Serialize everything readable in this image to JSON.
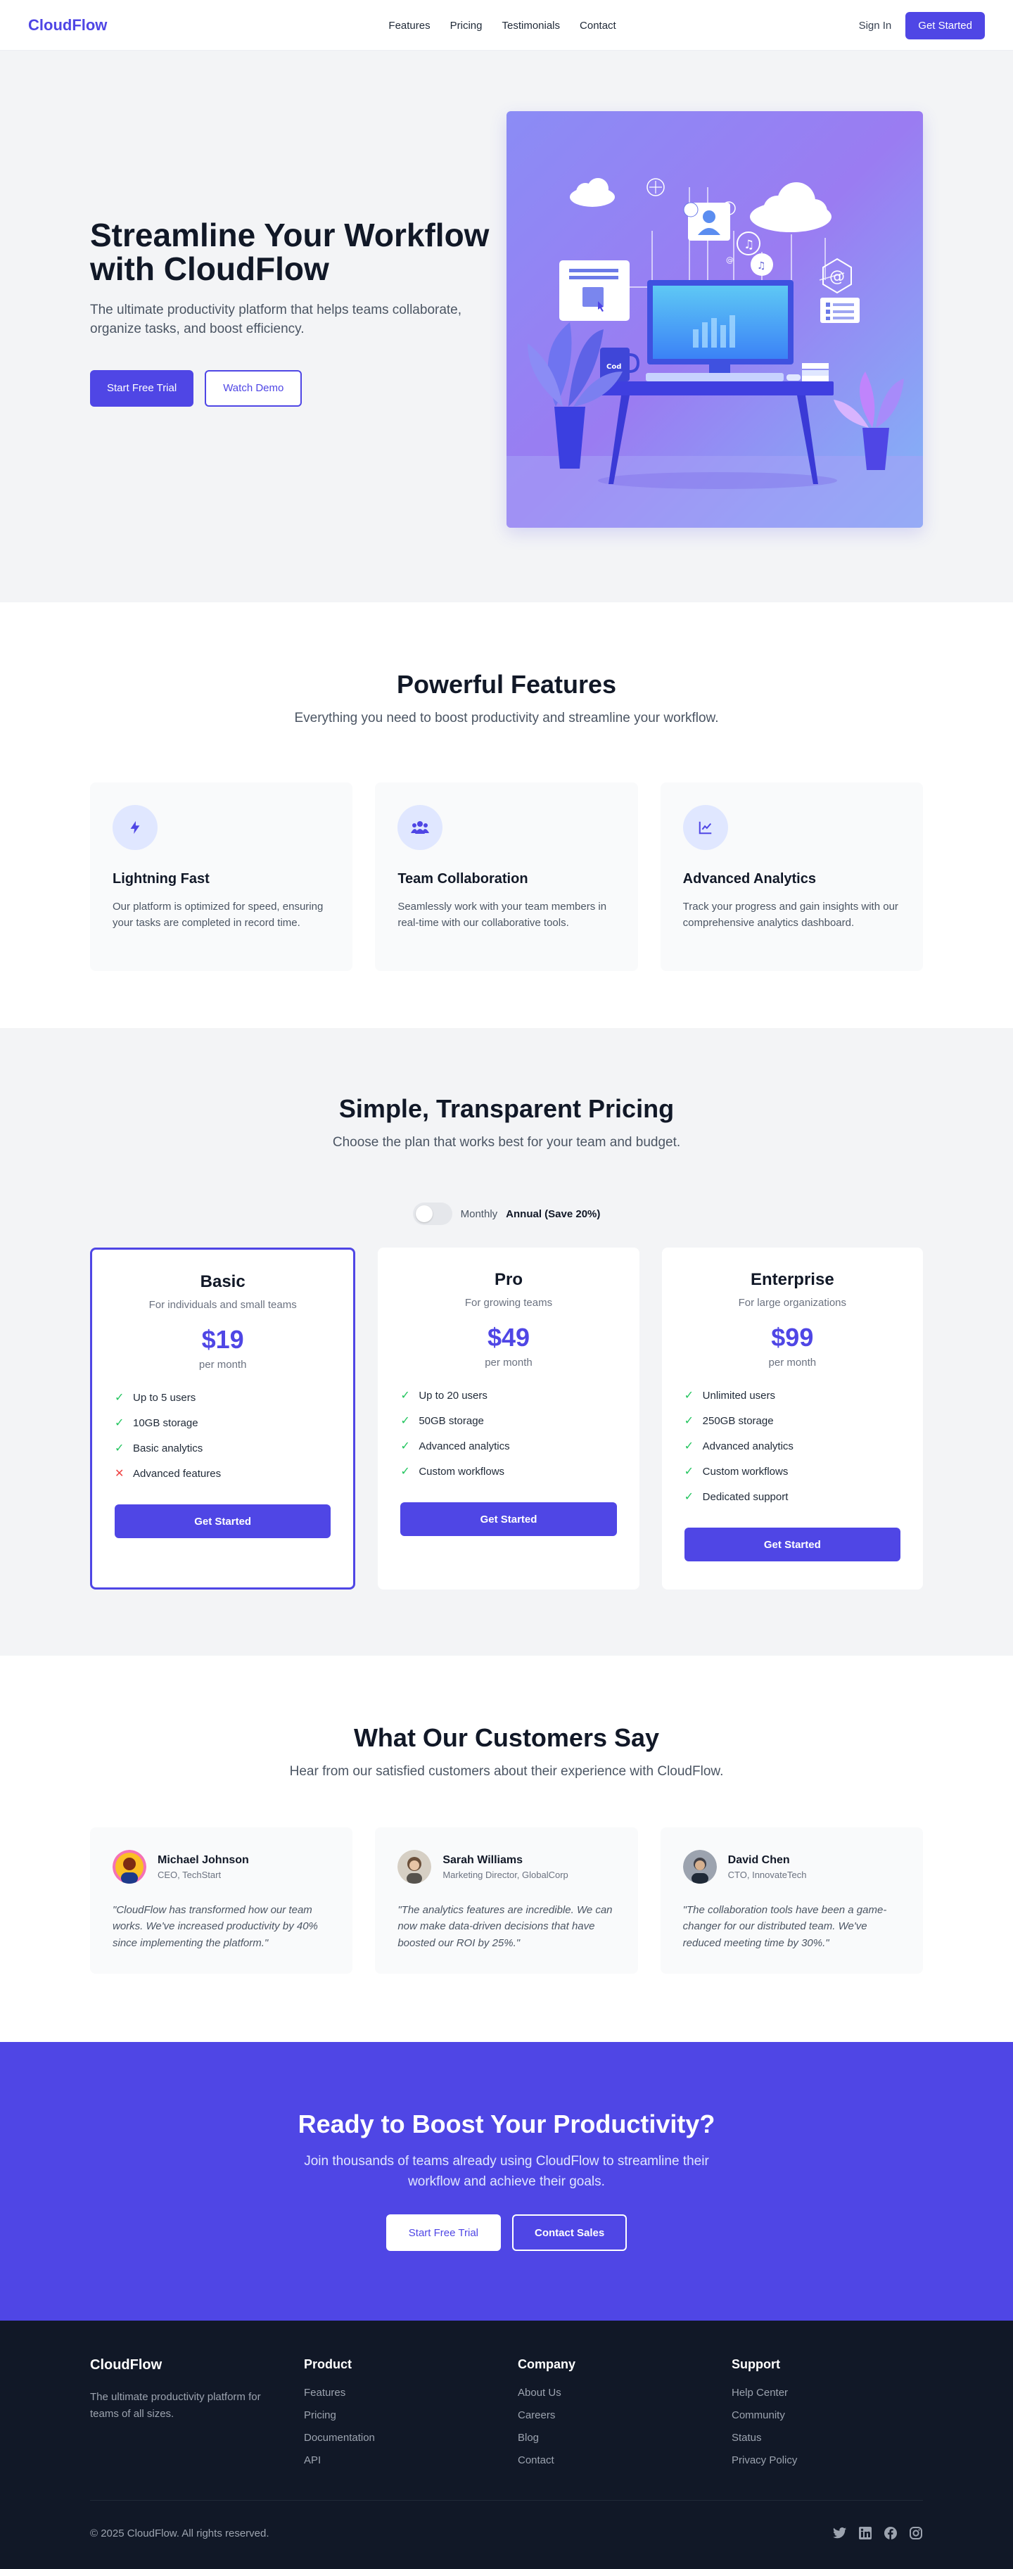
{
  "header": {
    "logo": "CloudFlow",
    "nav": [
      "Features",
      "Pricing",
      "Testimonials",
      "Contact"
    ],
    "signin": "Sign In",
    "cta": "Get Started"
  },
  "hero": {
    "title": "Streamline Your Workflow with CloudFlow",
    "subtitle": "The ultimate productivity platform that helps teams collaborate, organize tasks, and boost efficiency.",
    "primary_button": "Start Free Trial",
    "secondary_button": "Watch Demo",
    "mug_text": "Cod"
  },
  "features": {
    "title": "Powerful Features",
    "subtitle": "Everything you need to boost productivity and streamline your workflow.",
    "items": [
      {
        "icon": "bolt-icon",
        "title": "Lightning Fast",
        "desc": "Our platform is optimized for speed, ensuring your tasks are completed in record time."
      },
      {
        "icon": "users-icon",
        "title": "Team Collaboration",
        "desc": "Seamlessly work with your team members in real-time with our collaborative tools."
      },
      {
        "icon": "chart-line-icon",
        "title": "Advanced Analytics",
        "desc": "Track your progress and gain insights with our comprehensive analytics dashboard."
      }
    ]
  },
  "pricing": {
    "title": "Simple, Transparent Pricing",
    "subtitle": "Choose the plan that works best for your team and budget.",
    "toggle_monthly": "Monthly",
    "toggle_annual": "Annual (Save 20%)",
    "toggle_on": false,
    "plans": [
      {
        "name": "Basic",
        "for": "For individuals and small teams",
        "price": "$19",
        "period": "per month",
        "button": "Get Started",
        "features": [
          {
            "text": "Up to 5 users",
            "included": true
          },
          {
            "text": "10GB storage",
            "included": true
          },
          {
            "text": "Basic analytics",
            "included": true
          },
          {
            "text": "Advanced features",
            "included": false
          }
        ]
      },
      {
        "name": "Pro",
        "for": "For growing teams",
        "price": "$49",
        "period": "per month",
        "button": "Get Started",
        "features": [
          {
            "text": "Up to 20 users",
            "included": true
          },
          {
            "text": "50GB storage",
            "included": true
          },
          {
            "text": "Advanced analytics",
            "included": true
          },
          {
            "text": "Custom workflows",
            "included": true
          }
        ]
      },
      {
        "name": "Enterprise",
        "for": "For large organizations",
        "price": "$99",
        "period": "per month",
        "button": "Get Started",
        "features": [
          {
            "text": "Unlimited users",
            "included": true
          },
          {
            "text": "250GB storage",
            "included": true
          },
          {
            "text": "Advanced analytics",
            "included": true
          },
          {
            "text": "Custom workflows",
            "included": true
          },
          {
            "text": "Dedicated support",
            "included": true
          }
        ]
      }
    ]
  },
  "testimonials": {
    "title": "What Our Customers Say",
    "subtitle": "Hear from our satisfied customers about their experience with CloudFlow.",
    "items": [
      {
        "name": "Michael Johnson",
        "role": "CEO, TechStart",
        "quote": "\"CloudFlow has transformed how our team works. We've increased productivity by 40% since implementing the platform.\""
      },
      {
        "name": "Sarah Williams",
        "role": "Marketing Director, GlobalCorp",
        "quote": "\"The analytics features are incredible. We can now make data-driven decisions that have boosted our ROI by 25%.\""
      },
      {
        "name": "David Chen",
        "role": "CTO, InnovateTech",
        "quote": "\"The collaboration tools have been a game-changer for our distributed team. We've reduced meeting time by 30%.\""
      }
    ]
  },
  "cta": {
    "title": "Ready to Boost Your Productivity?",
    "subtitle": "Join thousands of teams already using CloudFlow to streamline their workflow and achieve their goals.",
    "primary_button": "Start Free Trial",
    "secondary_button": "Contact Sales"
  },
  "footer": {
    "brand": "CloudFlow",
    "desc": "The ultimate productivity platform for teams of all sizes.",
    "columns": [
      {
        "title": "Product",
        "links": [
          "Features",
          "Pricing",
          "Documentation",
          "API"
        ]
      },
      {
        "title": "Company",
        "links": [
          "About Us",
          "Careers",
          "Blog",
          "Contact"
        ]
      },
      {
        "title": "Support",
        "links": [
          "Help Center",
          "Community",
          "Status",
          "Privacy Policy"
        ]
      }
    ],
    "copyright": "© 2025 CloudFlow. All rights reserved.",
    "social": [
      "twitter-icon",
      "linkedin-icon",
      "facebook-icon",
      "instagram-icon"
    ]
  },
  "colors": {
    "brand": "#4f46e5",
    "dark": "#111827",
    "check": "#22c55e",
    "cross": "#ef4444"
  }
}
